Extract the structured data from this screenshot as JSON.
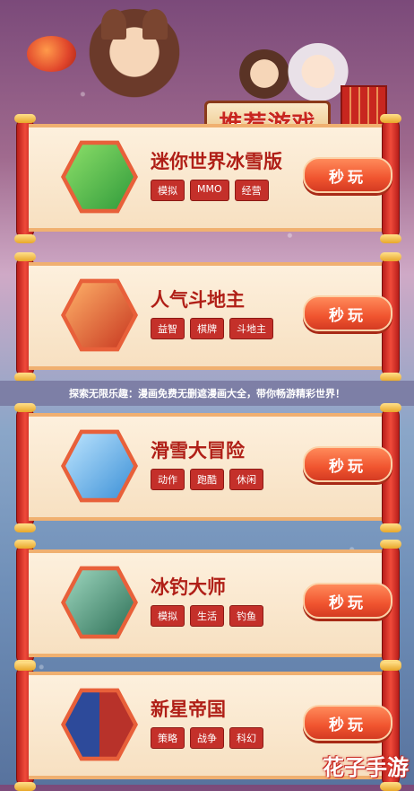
{
  "header": {
    "banner_title": "推荐游戏"
  },
  "notice": {
    "text": "探索无限乐趣：漫画免费无删遮漫画大全，带你畅游精彩世界！"
  },
  "games": [
    {
      "title": "迷你世界冰雪版",
      "tags": [
        "模拟",
        "MMO",
        "经营"
      ],
      "play_label": "秒玩",
      "icon": "mini-world-cube-character-icon",
      "icon_color": "#5ac25a"
    },
    {
      "title": "人气斗地主",
      "tags": [
        "益智",
        "棋牌",
        "斗地主"
      ],
      "play_label": "秒玩",
      "icon": "landlord-character-icon",
      "icon_color": "#d8442c"
    },
    {
      "title": "滑雪大冒险",
      "tags": [
        "动作",
        "跑酷",
        "休闲"
      ],
      "play_label": "秒玩",
      "icon": "skier-character-icon",
      "icon_color": "#4aa3e0"
    },
    {
      "title": "冰钓大师",
      "tags": [
        "模拟",
        "生活",
        "钓鱼"
      ],
      "play_label": "秒玩",
      "icon": "fish-icon",
      "icon_color": "#3b8a6a"
    },
    {
      "title": "新星帝国",
      "tags": [
        "策略",
        "战争",
        "科幻"
      ],
      "play_label": "秒玩",
      "icon": "warrior-face-icon",
      "icon_color": "#3a4f8a"
    }
  ],
  "watermark": "花子手游",
  "colors": {
    "accent_red": "#c8261f",
    "play_button": "#f0542f",
    "paper": "#fdf0dd"
  }
}
